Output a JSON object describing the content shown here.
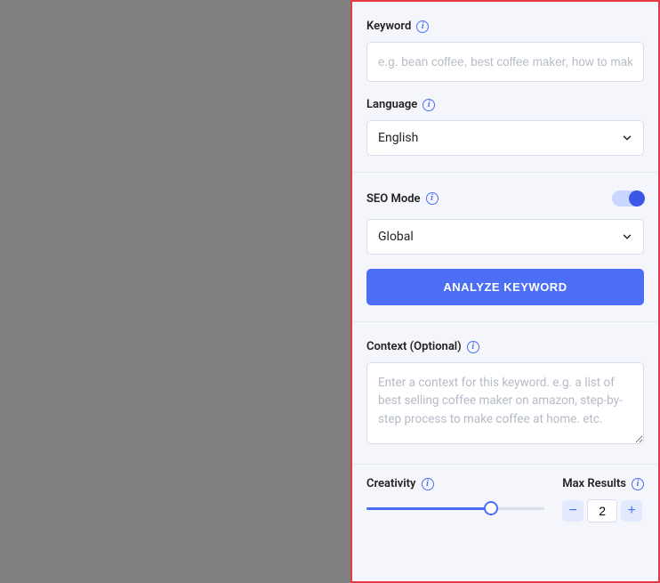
{
  "keyword": {
    "label": "Keyword",
    "placeholder": "e.g. bean coffee, best coffee maker, how to make...",
    "value": ""
  },
  "language": {
    "label": "Language",
    "selected": "English"
  },
  "seo": {
    "label": "SEO Mode",
    "enabled": true,
    "scope_selected": "Global"
  },
  "analyze_button": "ANALYZE KEYWORD",
  "context": {
    "label": "Context (Optional)",
    "placeholder": "Enter a context for this keyword. e.g. a list of best selling coffee maker on amazon, step-by-step process to make coffee at home. etc.",
    "value": ""
  },
  "creativity": {
    "label": "Creativity",
    "percent": 70
  },
  "max_results": {
    "label": "Max Results",
    "value": "2"
  },
  "colors": {
    "accent": "#4b6ef5",
    "panel_bg": "#f4f6fb",
    "highlight_border": "#e63946"
  }
}
